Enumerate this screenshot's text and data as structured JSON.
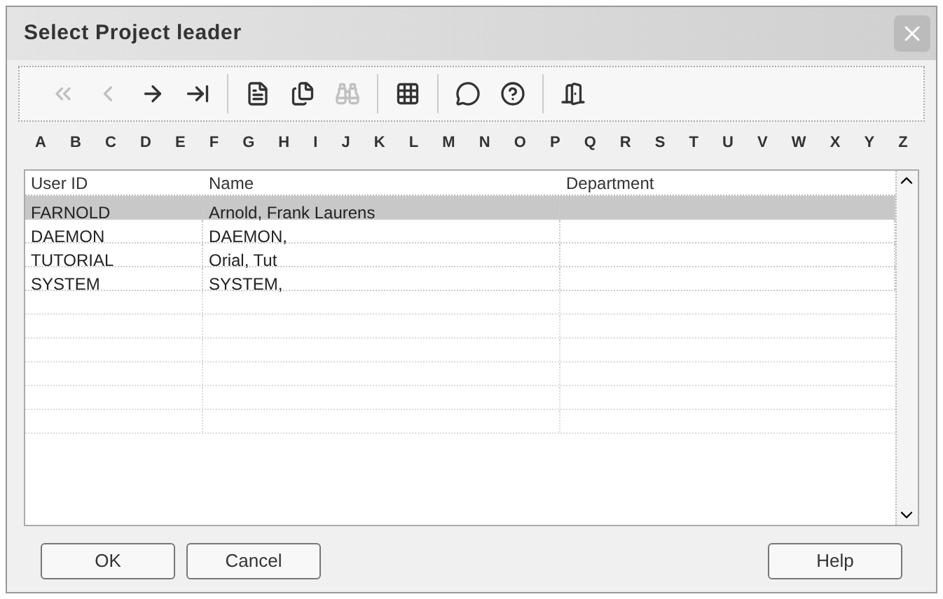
{
  "window": {
    "title": "Select Project leader"
  },
  "toolbar": [
    {
      "kind": "first",
      "disabled": true
    },
    {
      "kind": "prev",
      "disabled": true
    },
    {
      "kind": "next",
      "disabled": false
    },
    {
      "kind": "last",
      "disabled": false
    },
    {
      "kind": "sep"
    },
    {
      "kind": "doc",
      "disabled": false
    },
    {
      "kind": "docs",
      "disabled": false
    },
    {
      "kind": "find",
      "disabled": true
    },
    {
      "kind": "sep"
    },
    {
      "kind": "grid",
      "disabled": false
    },
    {
      "kind": "sep"
    },
    {
      "kind": "comment",
      "disabled": false
    },
    {
      "kind": "help",
      "disabled": false
    },
    {
      "kind": "sep"
    },
    {
      "kind": "exit",
      "disabled": false
    }
  ],
  "alphabet": [
    "A",
    "B",
    "C",
    "D",
    "E",
    "F",
    "G",
    "H",
    "I",
    "J",
    "K",
    "L",
    "M",
    "N",
    "O",
    "P",
    "Q",
    "R",
    "S",
    "T",
    "U",
    "V",
    "W",
    "X",
    "Y",
    "Z"
  ],
  "table": {
    "columns": [
      "User ID",
      "Name",
      "Department"
    ],
    "rows": [
      {
        "cells": [
          "FARNOLD",
          "Arnold, Frank Laurens"
        ],
        "selected": true
      },
      {
        "cells": [
          "DAEMON",
          "DAEMON,"
        ],
        "selected": false
      },
      {
        "cells": [
          "TUTORIAL",
          "Orial, Tut"
        ],
        "selected": false
      },
      {
        "cells": [
          "SYSTEM",
          "SYSTEM,"
        ],
        "selected": false
      }
    ]
  },
  "buttons": [
    "OK",
    "Cancel"
  ],
  "help_button": "Help"
}
